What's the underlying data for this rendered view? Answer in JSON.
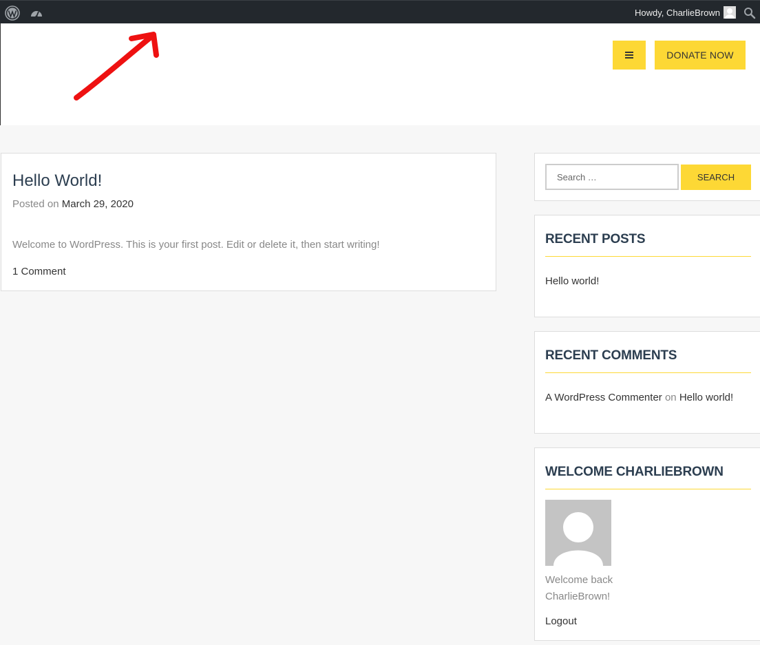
{
  "adminbar": {
    "howdy": "Howdy, CharlieBrown",
    "icons": [
      "wordpress-icon",
      "dashboard-icon",
      "avatar",
      "search-icon"
    ]
  },
  "header": {
    "donate_label": "DONATE NOW",
    "menu_icon": "hamburger-icon",
    "accent_color": "#fdd835"
  },
  "post": {
    "title": "Hello World!",
    "posted_on_label": "Posted on",
    "date": "March 29, 2020",
    "excerpt": "Welcome to WordPress. This is your first post. Edit or delete it, then start writing!",
    "comments": "1 Comment"
  },
  "sidebar": {
    "search": {
      "placeholder": "Search …",
      "button_label": "SEARCH"
    },
    "recent_posts": {
      "title": "RECENT POSTS",
      "items": [
        "Hello world!"
      ]
    },
    "recent_comments": {
      "title": "RECENT COMMENTS",
      "author": "A WordPress Commenter",
      "on_label": "on",
      "post": "Hello world!"
    },
    "welcome": {
      "title": "WELCOME CHARLIEBROWN",
      "line1": "Welcome back",
      "line2": "CharlieBrown!",
      "logout": "Logout"
    }
  }
}
